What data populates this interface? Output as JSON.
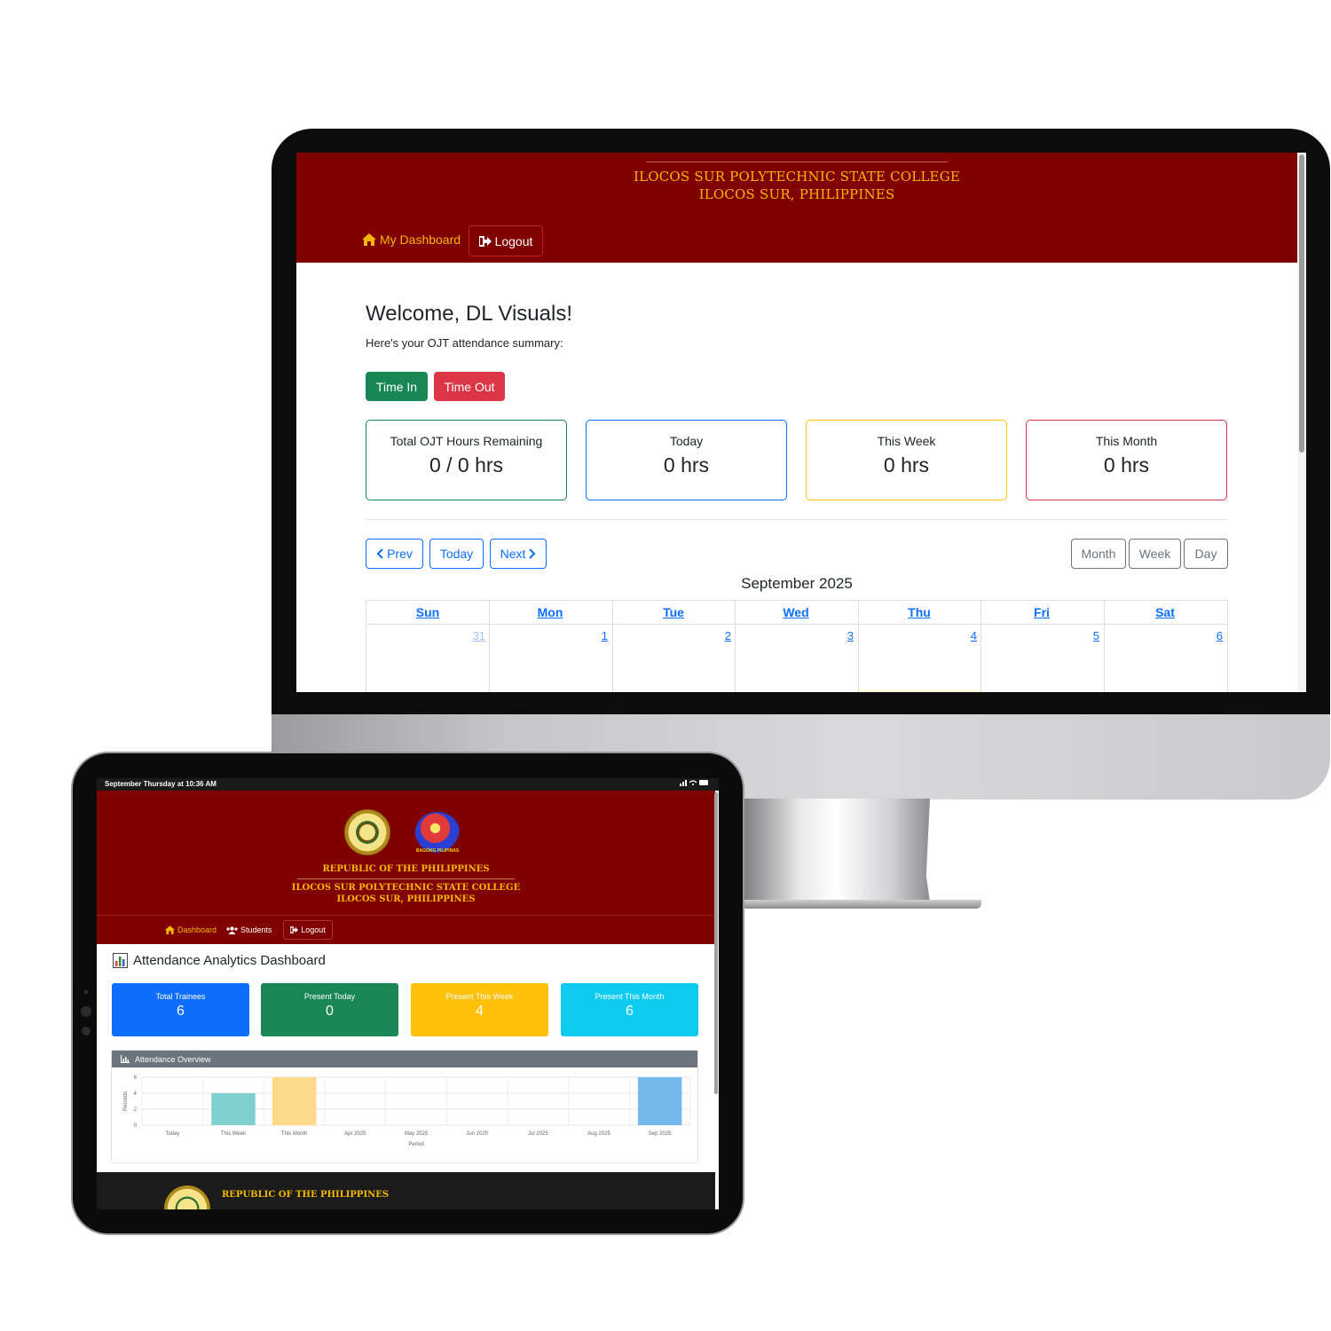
{
  "desktop": {
    "header": {
      "college": "ILOCOS SUR POLYTECHNIC STATE COLLEGE",
      "province": "ILOCOS SUR, PHILIPPINES"
    },
    "nav": {
      "dashboard": "My Dashboard",
      "logout": "Logout"
    },
    "welcome": "Welcome, DL Visuals!",
    "subtitle": "Here's your OJT attendance summary:",
    "buttons": {
      "time_in": "Time In",
      "time_out": "Time Out"
    },
    "cards": [
      {
        "label": "Total OJT Hours Remaining",
        "value": "0 / 0 hrs",
        "color": "#198754"
      },
      {
        "label": "Today",
        "value": "0 hrs",
        "color": "#0d6efd"
      },
      {
        "label": "This Week",
        "value": "0 hrs",
        "color": "#ffc107"
      },
      {
        "label": "This Month",
        "value": "0 hrs",
        "color": "#dc3545"
      }
    ],
    "calendar": {
      "prev": "Prev",
      "today": "Today",
      "next": "Next",
      "views": [
        "Month",
        "Week",
        "Day"
      ],
      "title": "September 2025",
      "days": [
        "Sun",
        "Mon",
        "Tue",
        "Wed",
        "Thu",
        "Fri",
        "Sat"
      ],
      "dates": [
        "31",
        "1",
        "2",
        "3",
        "4",
        "5",
        "6"
      ]
    }
  },
  "tablet": {
    "status_bar": {
      "time": "September Thursday at 10:36 AM",
      "icons": "signal-wifi-battery"
    },
    "header": {
      "republic": "REPUBLIC OF THE PHILIPPINES",
      "college": "ILOCOS SUR POLYTECHNIC STATE COLLEGE",
      "province": "ILOCOS SUR, PHILIPPINES",
      "logo_text": "BAGONG PILIPINAS"
    },
    "nav": {
      "dashboard": "Dashboard",
      "students": "Students",
      "logout": "Logout"
    },
    "title": "Attendance Analytics Dashboard",
    "cards": [
      {
        "label": "Total Trainees",
        "value": "6",
        "color": "#0d6efd"
      },
      {
        "label": "Present Today",
        "value": "0",
        "color": "#198754"
      },
      {
        "label": "Present This Week",
        "value": "4",
        "color": "#ffc107"
      },
      {
        "label": "Present This Month",
        "value": "6",
        "color": "#0dcaf0"
      }
    ],
    "panel_title": "Attendance Overview",
    "footer": {
      "republic": "REPUBLIC OF THE PHILIPPINES"
    }
  },
  "chart_data": {
    "type": "bar",
    "title": "Attendance Overview",
    "categories": [
      "Today",
      "This Week",
      "This Month",
      "Apr 2025",
      "May 2025",
      "Jun 2025",
      "Jul 2025",
      "Aug 2025",
      "Sep 2025"
    ],
    "values": [
      0,
      4,
      6,
      0,
      0,
      0,
      0,
      0,
      6
    ],
    "colors": [
      "#ff9999",
      "#80cfcf",
      "#ffd98a",
      "#c9b3ff",
      "#ffb27a",
      "#cccccc",
      "#ff9999",
      "#80cfcf",
      "#74b9ee"
    ],
    "xlabel": "Period",
    "ylabel": "Records",
    "ylim": [
      0,
      6
    ],
    "yticks": [
      0,
      2,
      4,
      6
    ],
    "grid": true,
    "legend": "none"
  }
}
